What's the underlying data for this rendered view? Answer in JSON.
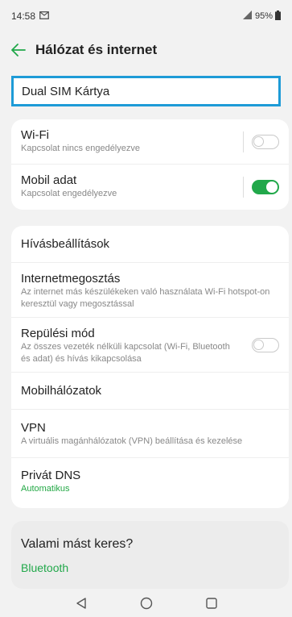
{
  "status": {
    "time": "14:58",
    "battery": "95%",
    "icons": [
      "message-icon",
      "signal-icon",
      "battery-icon"
    ]
  },
  "header": {
    "title": "Hálózat és internet"
  },
  "highlight": {
    "label": "Dual SIM Kártya"
  },
  "toggles_section": [
    {
      "title": "Wi-Fi",
      "subtitle": "Kapcsolat nincs engedélyezve",
      "state": "off"
    },
    {
      "title": "Mobil adat",
      "subtitle": "Kapcsolat engedélyezve",
      "state": "on"
    }
  ],
  "settings": {
    "calls": {
      "title": "Hívásbeállítások"
    },
    "tethering": {
      "title": "Internetmegosztás",
      "subtitle": "Az internet más készülékeken való használata Wi-Fi hotspot-on keresztül vagy megosztással"
    },
    "airplane": {
      "title": "Repülési mód",
      "subtitle": "Az összes vezeték nélküli kapcsolat (Wi-Fi, Bluetooth és adat) és hívás kikapcsolása",
      "state": "off"
    },
    "mobile_networks": {
      "title": "Mobilhálózatok"
    },
    "vpn": {
      "title": "VPN",
      "subtitle": "A virtuális magánhálózatok (VPN) beállítása és kezelése"
    },
    "private_dns": {
      "title": "Privát DNS",
      "subtitle": "Automatikus"
    }
  },
  "suggestions": {
    "title": "Valami mást keres?",
    "link": "Bluetooth"
  },
  "colors": {
    "accent": "#21a84a",
    "highlight_border": "#1e9bd7"
  }
}
